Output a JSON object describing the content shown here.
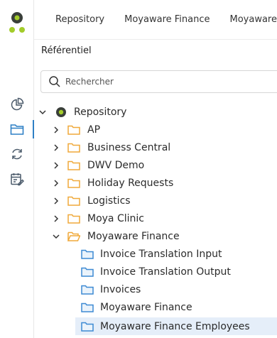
{
  "breadcrumb": [
    "Repository",
    "Moyaware Finance",
    "Moyaware Finance"
  ],
  "panel": {
    "title": "Référentiel"
  },
  "search": {
    "placeholder": "Rechercher"
  },
  "tree": {
    "root": "Repository",
    "folders": [
      "AP",
      "Business Central",
      "DWV Demo",
      "Holiday Requests",
      "Logistics",
      "Moya Clinic",
      "Moyaware Finance"
    ],
    "expanded_children": [
      "Invoice Translation Input",
      "Invoice Translation Output",
      "Invoices",
      "Moyaware Finance",
      "Moyaware Finance Employees"
    ],
    "selected": "Moyaware Finance Employees"
  },
  "colors": {
    "logo_dark": "#3a3f3a",
    "logo_green": "#a3cc2a",
    "folder_yellow": "#f0a93a",
    "repo_item_blue": "#3d8ad3",
    "active_accent": "#2f80c5",
    "selected_bg": "#e5eef9"
  },
  "icons": [
    "app-logo",
    "pie-chart-icon",
    "folder-icon",
    "sync-icon",
    "calendar-edit-icon",
    "search-icon",
    "chevron-right-icon",
    "chevron-down-icon"
  ]
}
